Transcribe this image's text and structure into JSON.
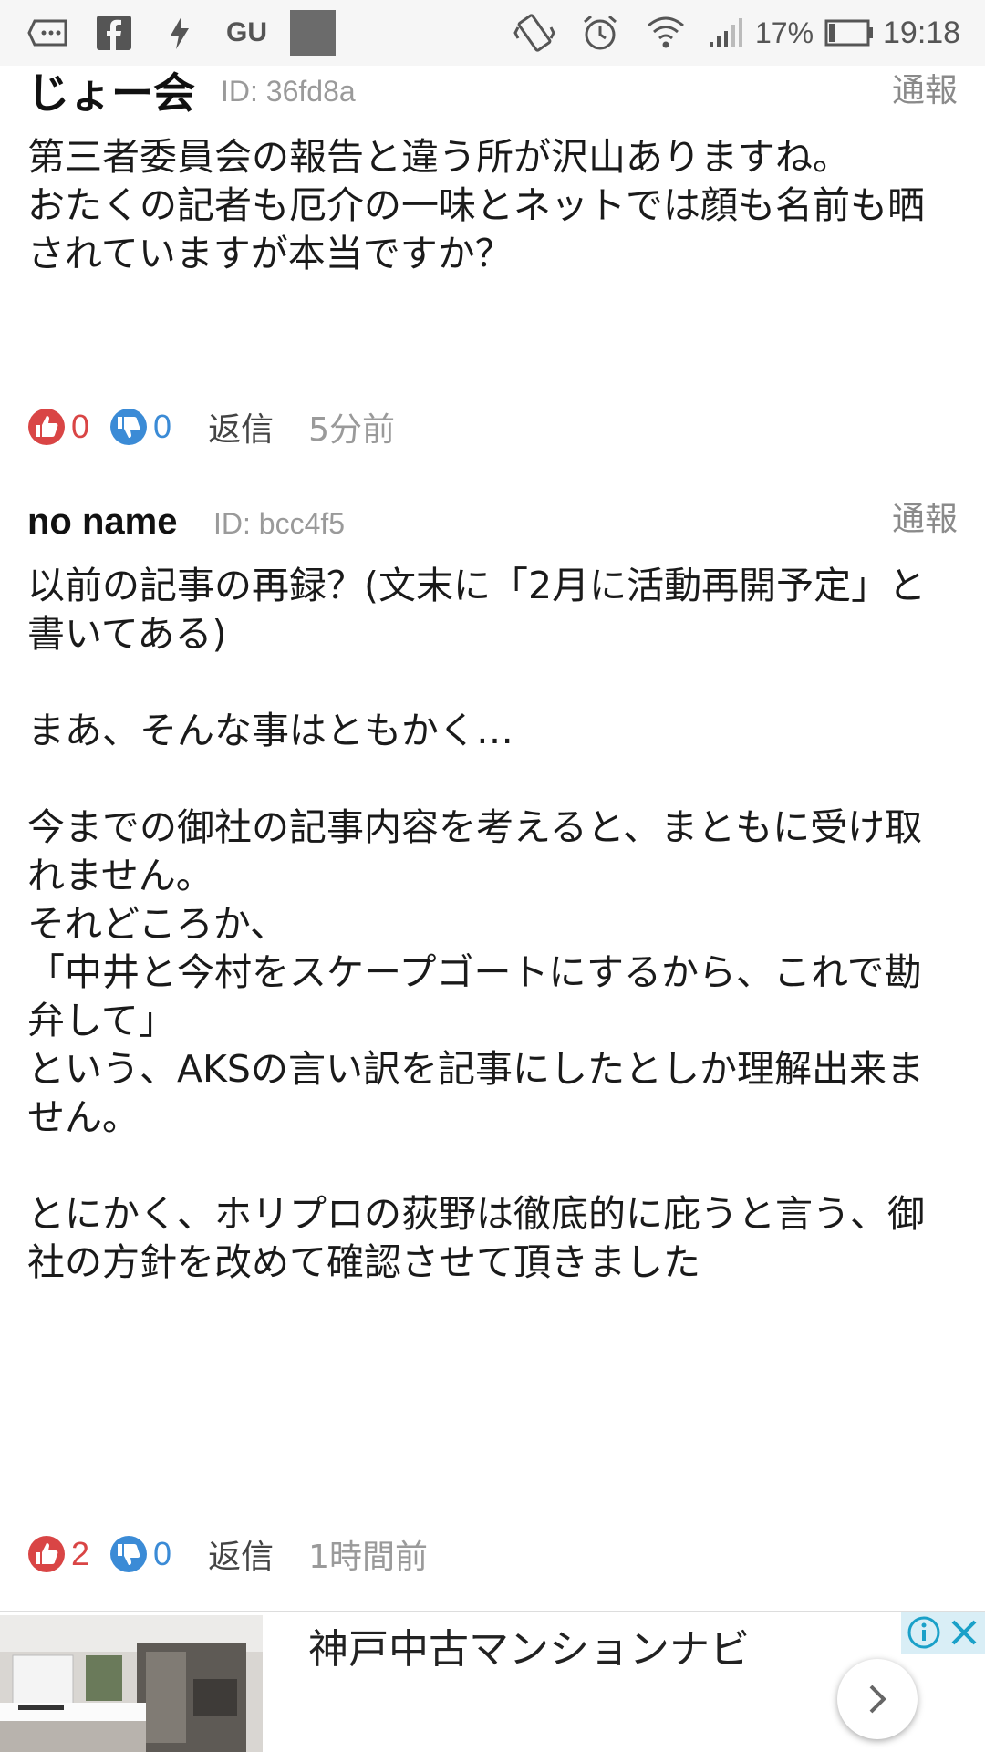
{
  "status_bar": {
    "app_label": "GU",
    "battery_percent": "17%",
    "time": "19:18"
  },
  "comments": [
    {
      "name": "じょー会",
      "id": "ID: 36fd8a",
      "report": "通報",
      "body": "第三者委員会の報告と違う所が沢山ありますね。\nおたくの記者も厄介の一味とネットでは顔も名前も晒されていますが本当ですか？",
      "upvotes": "0",
      "downvotes": "0",
      "reply": "返信",
      "time": "5分前"
    },
    {
      "name": "no name",
      "id": "ID: bcc4f5",
      "report": "通報",
      "body": "以前の記事の再録？(文末に「2月に活動再開予定」と書いてある)\n\nまあ、そんな事はともかく…\n\n今までの御社の記事内容を考えると、まともに受け取れません。\nそれどころか、\n「中井と今村をスケープゴートにするから、これで勘弁して」\nという、AKSの言い訳を記事にしたとしか理解出来ません。\n\nとにかく、ホリプロの荻野は徹底的に庇うと言う、御社の方針を改めて確認させて頂きました",
      "upvotes": "2",
      "downvotes": "0",
      "reply": "返信",
      "time": "1時間前"
    }
  ],
  "ad": {
    "title": "神戸中古マンションナビ"
  }
}
